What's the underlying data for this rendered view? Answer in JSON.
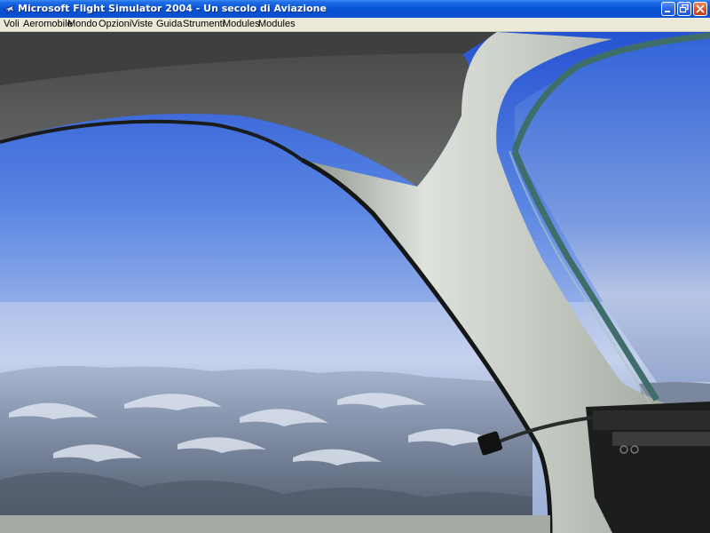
{
  "window": {
    "title": "Microsoft Flight Simulator 2004 - Un secolo di Aviazione",
    "icon": "flight-simulator-app-icon",
    "controls": [
      "minimize-icon",
      "restore-icon",
      "close-icon"
    ]
  },
  "menu": {
    "items": [
      {
        "label": "Voli"
      },
      {
        "label": "Aeromobile"
      },
      {
        "label": "Mondo"
      },
      {
        "label": "Opzioni"
      },
      {
        "label": "Viste"
      },
      {
        "label": "Guida"
      },
      {
        "label": "Strumenti"
      },
      {
        "label": "Modules"
      },
      {
        "label": "Modules"
      }
    ]
  },
  "scene": {
    "view": "cockpit-window-view",
    "sky_color_top": "#2b5cd6",
    "sky_color_horizon": "#c7d3ec",
    "terrain_color": "#6f7c93",
    "frame_color": "#c9ccc4"
  }
}
